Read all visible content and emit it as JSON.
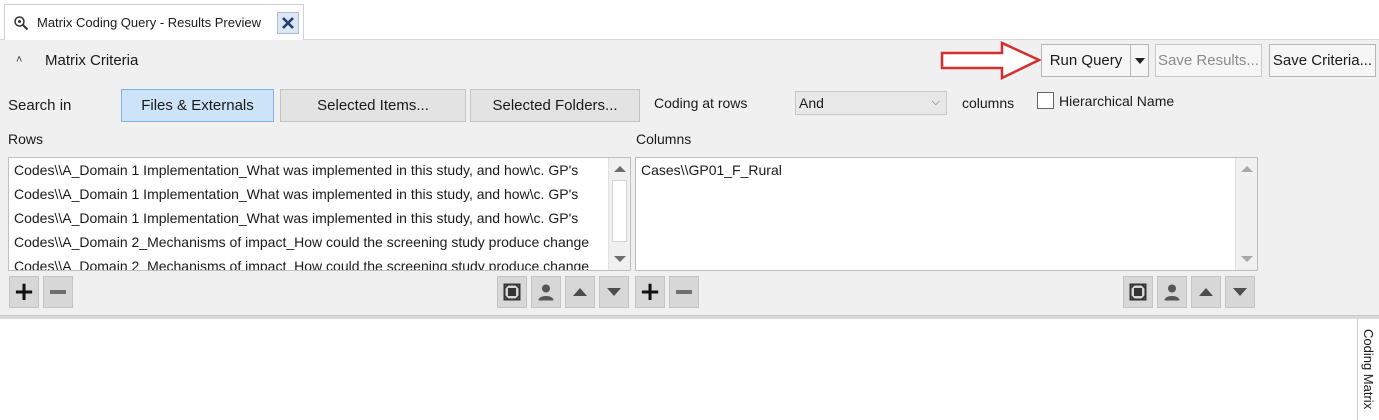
{
  "tab": {
    "title": "Matrix Coding Query - Results Preview",
    "icon": "magnifier-icon",
    "close_icon": "close-x-icon"
  },
  "criteria": {
    "title": "Matrix Criteria",
    "run_query_label": "Run Query",
    "save_results_label": "Save Results...",
    "save_criteria_label": "Save Criteria...",
    "search_in_label": "Search in",
    "files_externals_label": "Files & Externals",
    "selected_items_label": "Selected Items...",
    "selected_folders_label": "Selected Folders...",
    "coding_at_rows_label": "Coding at rows",
    "operator_value": "And",
    "columns_suffix_label": "columns",
    "hierarchical_name_label": "Hierarchical Name",
    "hierarchical_name_checked": false
  },
  "rows": {
    "label": "Rows",
    "items": [
      "Codes\\\\A_Domain 1 Implementation_What was implemented in this study, and how\\c. GP's",
      "Codes\\\\A_Domain 1 Implementation_What was implemented in this study, and how\\c. GP's",
      "Codes\\\\A_Domain 1 Implementation_What was implemented in this study, and how\\c. GP's",
      "Codes\\\\A_Domain 2_Mechanisms of impact_How could the screening study produce change",
      "Codes\\\\A_Domain 2_Mechanisms of impact_How could the screening study produce change"
    ]
  },
  "columns": {
    "label": "Columns",
    "items": [
      "Cases\\\\GP01_F_Rural"
    ]
  },
  "side_panel": {
    "label": "Coding Matrix"
  },
  "colors": {
    "annotation_arrow": "#d32f2f",
    "selected_toggle": "#cde3f7",
    "panel_bg": "#f0f0f0"
  }
}
